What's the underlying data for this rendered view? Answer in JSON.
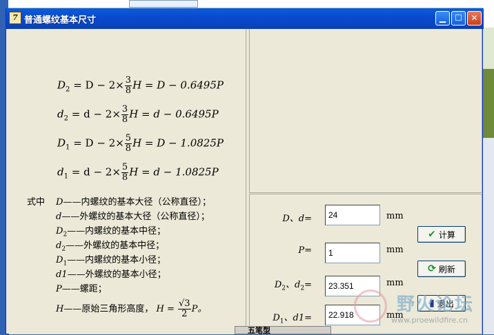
{
  "window": {
    "title": "普通螺纹基本尺寸",
    "app_icon_text": "7",
    "controls": {
      "minimize": "▁",
      "maximize": "☐",
      "close": "✕"
    }
  },
  "formulas": {
    "f1": {
      "lhs": "D",
      "lhs_sub": "2",
      "a": "= D − 2×",
      "num": "3",
      "den": "8",
      "b": "H = D − 0.6495P"
    },
    "f2": {
      "lhs": "d",
      "lhs_sub": "2",
      "a": "= d − 2×",
      "num": "3",
      "den": "8",
      "b": "H = d − 0.6495P"
    },
    "f3": {
      "lhs": "D",
      "lhs_sub": "1",
      "a": "= D − 2×",
      "num": "5",
      "den": "8",
      "b": "H = D − 1.0825P"
    },
    "f4": {
      "lhs": "d",
      "lhs_sub": "1",
      "a": "= d − 2×",
      "num": "5",
      "den": "8",
      "b": "H = d − 1.0825P"
    }
  },
  "definitions": {
    "intro": "式中",
    "items": [
      {
        "sym": "D",
        "sub": "",
        "text": "——内螺纹的基本大径（公称直径）；"
      },
      {
        "sym": "d",
        "sub": "",
        "text": "——外螺纹的基本大径（公称直径）；"
      },
      {
        "sym": "D",
        "sub": "2",
        "text": "——内螺纹的基本中径；"
      },
      {
        "sym": "d",
        "sub": "2",
        "text": "——外螺纹的基本中径；"
      },
      {
        "sym": "D",
        "sub": "1",
        "text": "——内螺纹的基本小径；"
      },
      {
        "sym": "d1",
        "sub": "",
        "text": "——外螺纹的基本小径；"
      },
      {
        "sym": "P",
        "sub": "",
        "text": "——螺距；"
      }
    ],
    "last": {
      "sym": "H",
      "text": "——原始三角形高度，",
      "expr_lhs": "H =",
      "num": "√3",
      "den": "2",
      "expr_rhs": "P。"
    }
  },
  "inputs": {
    "major": {
      "label": "D、d=",
      "value": "24",
      "unit": "mm"
    },
    "pitch": {
      "label": "P=",
      "value": "1",
      "unit": "mm"
    },
    "pitch_dia": {
      "label_a": "D",
      "label_sub_a": "2",
      "label_b": "、d",
      "label_sub_b": "2",
      "label_c": "=",
      "value": "23.351",
      "unit": "mm"
    },
    "minor": {
      "label": "D",
      "label_sub": "1",
      "label_b": "、d1=",
      "value": "22.918",
      "unit": "mm"
    }
  },
  "buttons": {
    "calc": {
      "label": "计算",
      "icon": "checkmark-icon",
      "glyph": "✔"
    },
    "refresh": {
      "label": "刷新",
      "icon": "refresh-icon",
      "glyph": "⟳"
    },
    "exit": {
      "label": "退出",
      "icon": "exit-door-icon",
      "glyph": "▮"
    }
  },
  "watermark": {
    "title": "野火论坛",
    "url": "www.proewildfire.cn"
  },
  "taskbar_strip": {
    "label": "五笔型"
  },
  "colors": {
    "titlebar": "#0a5fd8",
    "window_bg": "#ece9d8",
    "check": "#1a9a2a",
    "refresh": "#1a8a2a"
  }
}
